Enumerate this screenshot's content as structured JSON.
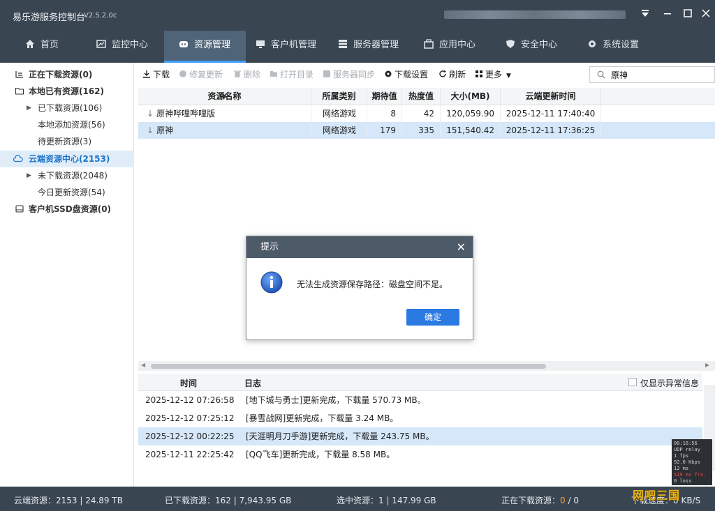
{
  "window": {
    "title": "易乐游服务控制台",
    "version": "V2.5.2.0c"
  },
  "nav": {
    "tabs": [
      {
        "label": "首页",
        "icon": "home-icon"
      },
      {
        "label": "监控中心",
        "icon": "monitor-chart-icon"
      },
      {
        "label": "资源管理",
        "icon": "resource-icon"
      },
      {
        "label": "客户机管理",
        "icon": "desktop-icon"
      },
      {
        "label": "服务器管理",
        "icon": "server-icon"
      },
      {
        "label": "应用中心",
        "icon": "app-center-icon"
      },
      {
        "label": "安全中心",
        "icon": "shield-icon"
      },
      {
        "label": "系统设置",
        "icon": "gear-icon"
      }
    ],
    "active_index": 2
  },
  "sidebar": {
    "items": [
      {
        "label": "正在下载资源(0)"
      },
      {
        "label": "本地已有资源(162)"
      },
      {
        "label": "已下载资源(106)"
      },
      {
        "label": "本地添加资源(56)"
      },
      {
        "label": "待更新资源(3)"
      },
      {
        "label": "云端资源中心(2153)"
      },
      {
        "label": "未下载资源(2048)"
      },
      {
        "label": "今日更新资源(54)"
      },
      {
        "label": "客户机SSD盘资源(0)"
      }
    ]
  },
  "toolbar": {
    "download": "下载",
    "repair_update": "修复更新",
    "delete": "删除",
    "open_dir": "打开目录",
    "server_sync": "服务器同步",
    "download_settings": "下载设置",
    "refresh": "刷新",
    "more": "更多"
  },
  "search": {
    "value": "原神"
  },
  "resource_table": {
    "columns": [
      "资源名称",
      "所属类别",
      "期待值",
      "热度值",
      "大小(MB)",
      "云端更新时间"
    ],
    "rows": [
      {
        "name": "原神哔哩哔哩版",
        "category": "网络游戏",
        "expect": "8",
        "heat": "42",
        "size": "120,059.90",
        "updated": "2025-12-11 17:40:40"
      },
      {
        "name": "原神",
        "category": "网络游戏",
        "expect": "179",
        "heat": "335",
        "size": "151,540.42",
        "updated": "2025-12-11 17:36:25"
      }
    ]
  },
  "log_table": {
    "columns": [
      "时间",
      "日志"
    ],
    "only_abnormal_label": "仅显示异常信息",
    "rows": [
      {
        "time": "2025-12-12 07:26:58",
        "msg": "[地下城与勇士]更新完成，下载量 570.73 MB。"
      },
      {
        "time": "2025-12-12 07:25:12",
        "msg": "[暴雪战网]更新完成，下载量 3.24 MB。"
      },
      {
        "time": "2025-12-12 00:22:25",
        "msg": "[天涯明月刀手游]更新完成，下载量 243.75 MB。"
      },
      {
        "time": "2025-12-11 22:25:42",
        "msg": "[QQ飞车]更新完成，下载量 8.58 MB。"
      }
    ]
  },
  "dialog": {
    "title": "提示",
    "message": "无法生成资源保存路径：磁盘空间不足。",
    "ok_label": "确定"
  },
  "statusbar": {
    "cloud": "云端资源：2153 | 24.89 TB",
    "downloaded": "已下载资源：162 | 7,943.95 GB",
    "selected": "选中资源：1 | 147.99 GB",
    "downloading_label": "正在下载资源：",
    "downloading_value": "0",
    "downloading_total": " / 0",
    "speed": "下载速度：0 KB/S"
  },
  "overlay": {
    "lines": [
      "00:16:56",
      "UDP relay",
      "1 fps",
      "92.0 Kbps",
      "12 ms"
    ],
    "alert_line": "519 ms fra.",
    "extra_line": "0 loss"
  },
  "watermark": "网吧三国",
  "colors": {
    "chrome": "#3a4552",
    "active_tab": "#4f6477",
    "accent": "#2a7ae2",
    "selection": "#d5e7f8"
  }
}
